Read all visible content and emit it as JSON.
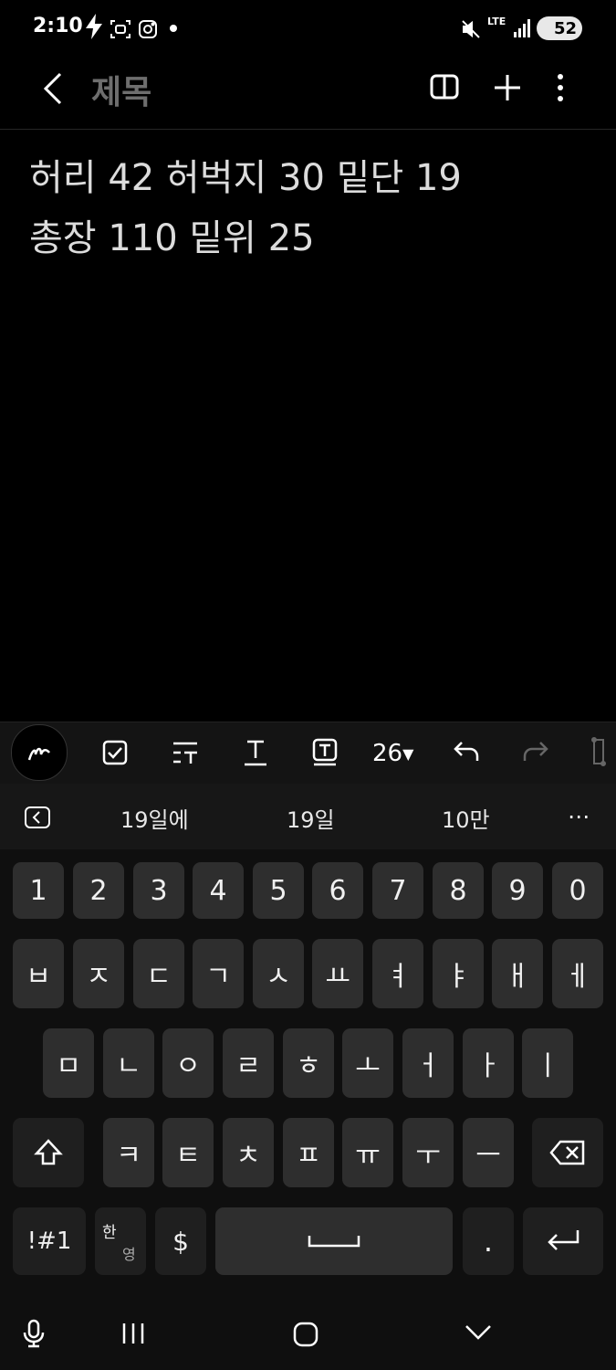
{
  "status_bar": {
    "time": "2:10",
    "network": "LTE",
    "battery": "52"
  },
  "app_bar": {
    "title": "제목"
  },
  "note": {
    "lines": [
      "허리 42 허벅지 30 밑단 19",
      "총장 110 밑위 25"
    ]
  },
  "toolbar": {
    "font_size": "26"
  },
  "suggestions": {
    "items": [
      "19일에",
      "19일",
      "10만"
    ]
  },
  "keyboard": {
    "row_numbers": [
      "1",
      "2",
      "3",
      "4",
      "5",
      "6",
      "7",
      "8",
      "9",
      "0"
    ],
    "row_1": [
      "ㅂ",
      "ㅈ",
      "ㄷ",
      "ㄱ",
      "ㅅ",
      "ㅛ",
      "ㅕ",
      "ㅑ",
      "ㅐ",
      "ㅔ"
    ],
    "row_2": [
      "ㅁ",
      "ㄴ",
      "ㅇ",
      "ㄹ",
      "ㅎ",
      "ㅗ",
      "ㅓ",
      "ㅏ",
      "ㅣ"
    ],
    "row_3": [
      "ㅋ",
      "ㅌ",
      "ㅊ",
      "ㅍ",
      "ㅠ",
      "ㅜ",
      "ㅡ"
    ],
    "symbols_label": "!#1",
    "lang_top": "한",
    "lang_bottom": "영",
    "currency": "$",
    "period": "."
  }
}
